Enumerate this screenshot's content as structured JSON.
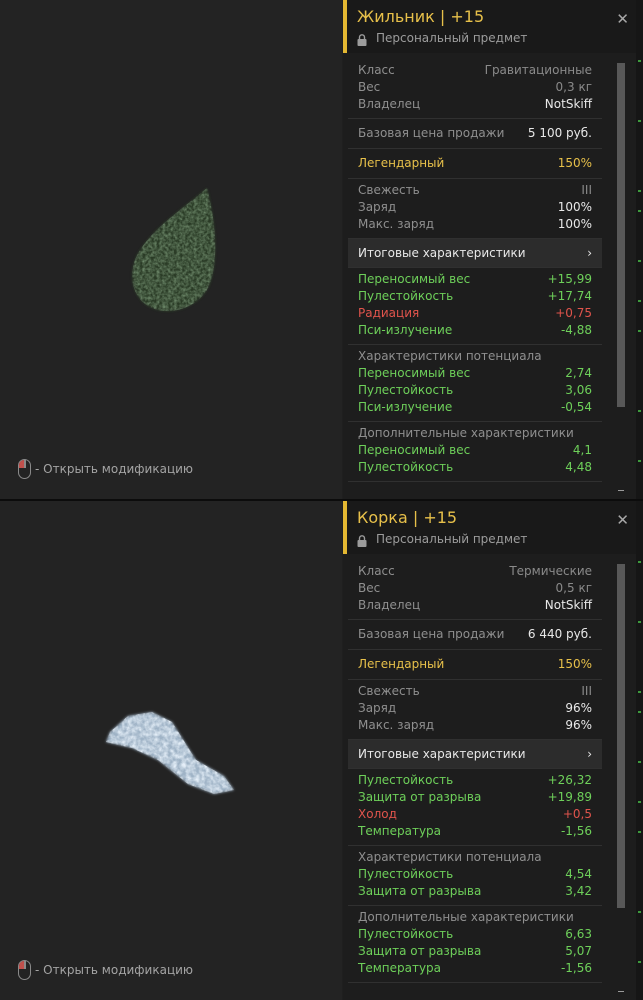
{
  "hint_label": "- Открыть модификацию",
  "screens": [
    {
      "artifact": "Жильник",
      "level": "+15",
      "subtitle": "Персональный предмет",
      "close_symbol": "✕",
      "info": [
        {
          "label": "Класс",
          "value": "Гравитационные"
        },
        {
          "label": "Вес",
          "value": "0,3 кг"
        },
        {
          "label": "Владелец",
          "value": "NotSkiff"
        }
      ],
      "price": {
        "label": "Базовая цена продажи",
        "value": "5 100 руб."
      },
      "rarity": {
        "label": "Легендарный",
        "value": "150%"
      },
      "state": [
        {
          "label": "Свежесть",
          "value": "III"
        },
        {
          "label": "Заряд",
          "value": "100%"
        },
        {
          "label": "Макс. заряд",
          "value": "100%"
        }
      ],
      "totals_header": "Итоговые характеристики",
      "totals_chevron": "›",
      "totals": [
        {
          "label": "Переносимый вес",
          "value": "+15,99",
          "tone": "positive"
        },
        {
          "label": "Пулестойкость",
          "value": "+17,74",
          "tone": "positive"
        },
        {
          "label": "Радиация",
          "value": "+0,75",
          "tone": "negative"
        },
        {
          "label": "Пси-излучение",
          "value": "-4,88",
          "tone": "positive"
        }
      ],
      "potential_header": "Характеристики потенциала",
      "potential": [
        {
          "label": "Переносимый вес",
          "value": "2,74",
          "tone": "positive"
        },
        {
          "label": "Пулестойкость",
          "value": "3,06",
          "tone": "positive"
        },
        {
          "label": "Пси-излучение",
          "value": "-0,54",
          "tone": "positive"
        }
      ],
      "extra_header": "Дополнительные характеристики",
      "extra": [
        {
          "label": "Переносимый вес",
          "value": "4,1",
          "tone": "positive"
        },
        {
          "label": "Пулестойкость",
          "value": "4,48",
          "tone": "positive"
        }
      ]
    },
    {
      "artifact": "Корка",
      "level": "+15",
      "subtitle": "Персональный предмет",
      "close_symbol": "✕",
      "info": [
        {
          "label": "Класс",
          "value": "Термические"
        },
        {
          "label": "Вес",
          "value": "0,5 кг"
        },
        {
          "label": "Владелец",
          "value": "NotSkiff"
        }
      ],
      "price": {
        "label": "Базовая цена продажи",
        "value": "6 440 руб."
      },
      "rarity": {
        "label": "Легендарный",
        "value": "150%"
      },
      "state": [
        {
          "label": "Свежесть",
          "value": "III"
        },
        {
          "label": "Заряд",
          "value": "96%"
        },
        {
          "label": "Макс. заряд",
          "value": "96%"
        }
      ],
      "totals_header": "Итоговые характеристики",
      "totals_chevron": "›",
      "totals": [
        {
          "label": "Пулестойкость",
          "value": "+26,32",
          "tone": "positive"
        },
        {
          "label": "Защита от разрыва",
          "value": "+19,89",
          "tone": "positive"
        },
        {
          "label": "Холод",
          "value": "+0,5",
          "tone": "negative"
        },
        {
          "label": "Температура",
          "value": "-1,56",
          "tone": "positive"
        }
      ],
      "potential_header": "Характеристики потенциала",
      "potential": [
        {
          "label": "Пулестойкость",
          "value": "4,54",
          "tone": "positive"
        },
        {
          "label": "Защита от разрыва",
          "value": "3,42",
          "tone": "positive"
        }
      ],
      "extra_header": "Дополнительные характеристики",
      "extra": [
        {
          "label": "Пулестойкость",
          "value": "6,63",
          "tone": "positive"
        },
        {
          "label": "Защита от разрыва",
          "value": "5,07",
          "tone": "positive"
        },
        {
          "label": "Температура",
          "value": "-1,56",
          "tone": "positive"
        }
      ]
    }
  ],
  "colors": {
    "accent_gold": "#e4b832",
    "title_gold": "#e7c04a",
    "positive_green": "#6ed05a",
    "negative_red": "#e0544c",
    "panel_bg": "#1d1d1d",
    "header_bar_bg": "#2c2c2c"
  },
  "icons": {
    "lock": "lock-icon",
    "mouse": "mouse-left-click-icon",
    "close": "close-icon",
    "chevron": "chevron-right-icon"
  }
}
